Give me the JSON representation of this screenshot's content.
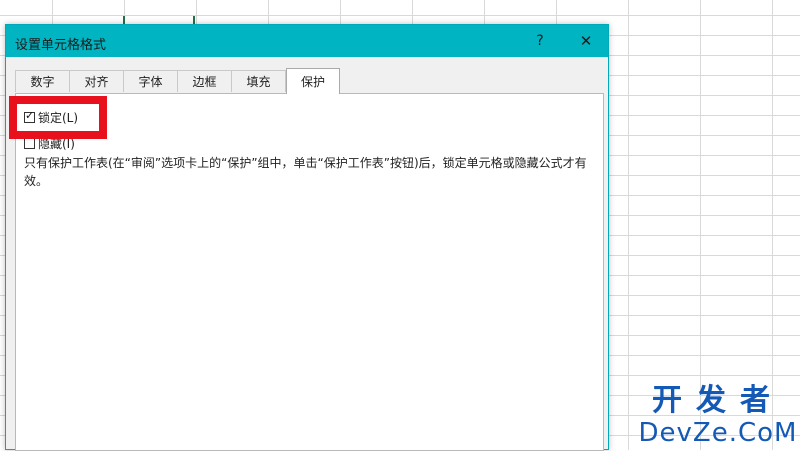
{
  "dialog": {
    "title": "设置单元格格式",
    "help_label": "?",
    "close_label": "✕",
    "tabs": [
      {
        "label": "数字",
        "active": false
      },
      {
        "label": "对齐",
        "active": false
      },
      {
        "label": "字体",
        "active": false
      },
      {
        "label": "边框",
        "active": false
      },
      {
        "label": "填充",
        "active": false
      },
      {
        "label": "保护",
        "active": true
      }
    ],
    "protection": {
      "locked": {
        "label": "锁定(L)",
        "checked": true
      },
      "hidden": {
        "label": "隐藏(I)",
        "checked": false
      },
      "description": "只有保护工作表(在“审阅”选项卡上的“保护”组中，单击“保护工作表”按钮)后，锁定单元格或隐藏公式才有效。"
    }
  },
  "watermark": {
    "line1": "开发者",
    "line2": "DevZe.CoM"
  },
  "colors": {
    "titlebar": "#00b4c2",
    "highlight": "#e8101c",
    "watermark": "#1459b5",
    "selected_cell_border": "#217346"
  }
}
